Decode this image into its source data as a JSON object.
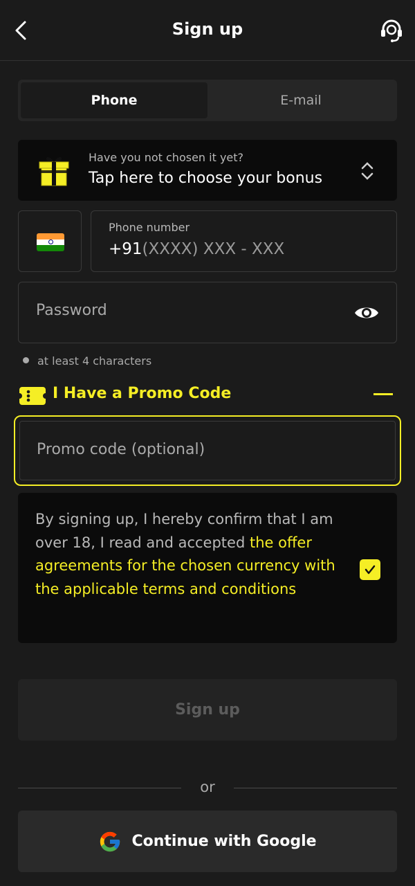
{
  "header": {
    "title": "Sign up",
    "back_icon": "chevron-left-icon",
    "support_icon": "headset-support-icon"
  },
  "tabs": [
    {
      "label": "Phone",
      "active": true
    },
    {
      "label": "E-mail",
      "active": false
    }
  ],
  "bonus": {
    "subtitle": "Have you not chosen it yet?",
    "title": "Tap here to choose your bonus",
    "icon": "gift-icon"
  },
  "phone": {
    "country_flag": "india-flag-icon",
    "label": "Phone number",
    "prefix": "+91",
    "placeholder": "(XXXX) XXX - XXX"
  },
  "password": {
    "placeholder": "Password",
    "hint": "at least 4 characters",
    "toggle_icon": "eye-icon"
  },
  "promo": {
    "toggle_label": "I Have a Promo Code",
    "placeholder": "Promo code (optional)",
    "expanded": true
  },
  "terms": {
    "text_before": "By signing up, I hereby confirm that I am over 18, I read and accepted ",
    "link_text": "the offer agreements for the chosen currency with the applicable terms and conditions",
    "checked": true
  },
  "actions": {
    "signup_label": "Sign up",
    "or_label": "or",
    "google_label": "Continue with Google"
  },
  "colors": {
    "accent": "#f5ee25",
    "background": "#1b1b1b",
    "card": "#0b0b0b"
  }
}
